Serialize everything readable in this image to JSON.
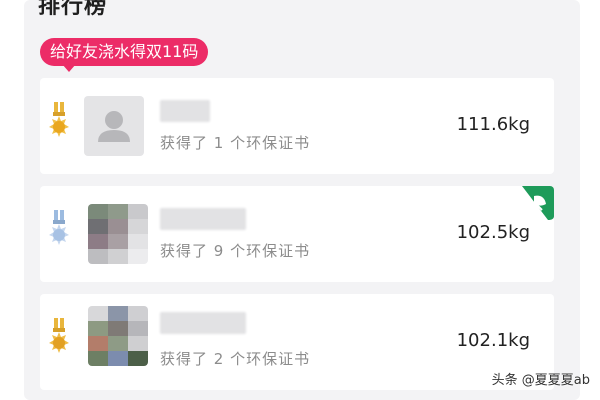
{
  "leaderboard": {
    "title": "排行榜",
    "promo_label": "给好友浇水得双11码",
    "entries": [
      {
        "rank": 1,
        "medal": "gold-medal-icon",
        "desc": "获得了 1 个环保证书",
        "weight": "111.6kg"
      },
      {
        "rank": 2,
        "medal": "silver-medal-icon",
        "desc": "获得了 9 个环保证书",
        "weight": "102.5kg",
        "badge": "leaf-badge-icon"
      },
      {
        "rank": 3,
        "medal": "bronze-medal-icon",
        "desc": "获得了 2 个环保证书",
        "weight": "102.1kg"
      }
    ]
  },
  "watermark": "头条 @夏夏夏ab",
  "colors": {
    "promo": "#ec2c67",
    "panel": "#f3f3f5",
    "gold": "#e9b63c",
    "silver": "#9cbbe0",
    "badge_green": "#1e9b5a"
  }
}
